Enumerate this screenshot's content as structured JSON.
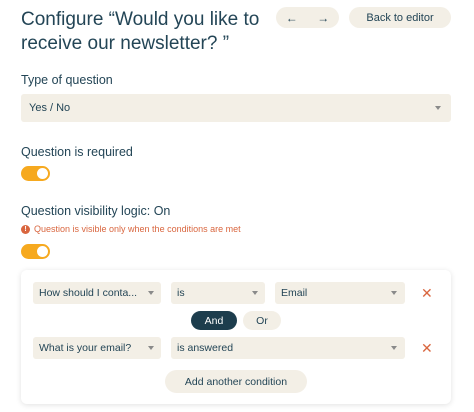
{
  "page": {
    "title": "Configure “Would you like to receive our newsletter? ”",
    "prev_icon": "arrow-left-icon",
    "next_icon": "arrow-right-icon",
    "back_label": "Back to editor"
  },
  "type_of_question": {
    "label": "Type of question",
    "value": "Yes / No"
  },
  "required": {
    "label": "Question is required",
    "on": true
  },
  "visibility": {
    "label": "Question visibility logic: On",
    "notice": "Question is visible only when the conditions are met",
    "on": true
  },
  "conditions": {
    "rows": [
      {
        "field": "How should I conta...",
        "operator": "is",
        "value": "Email"
      },
      {
        "field": "What is your email?",
        "operator": "is answered"
      }
    ],
    "and_label": "And",
    "or_label": "Or",
    "add_label": "Add another condition"
  },
  "colors": {
    "accent": "#f6a91f",
    "warning": "#d9663f",
    "dark": "#1d3d4d",
    "field_bg": "#f3efe6"
  }
}
